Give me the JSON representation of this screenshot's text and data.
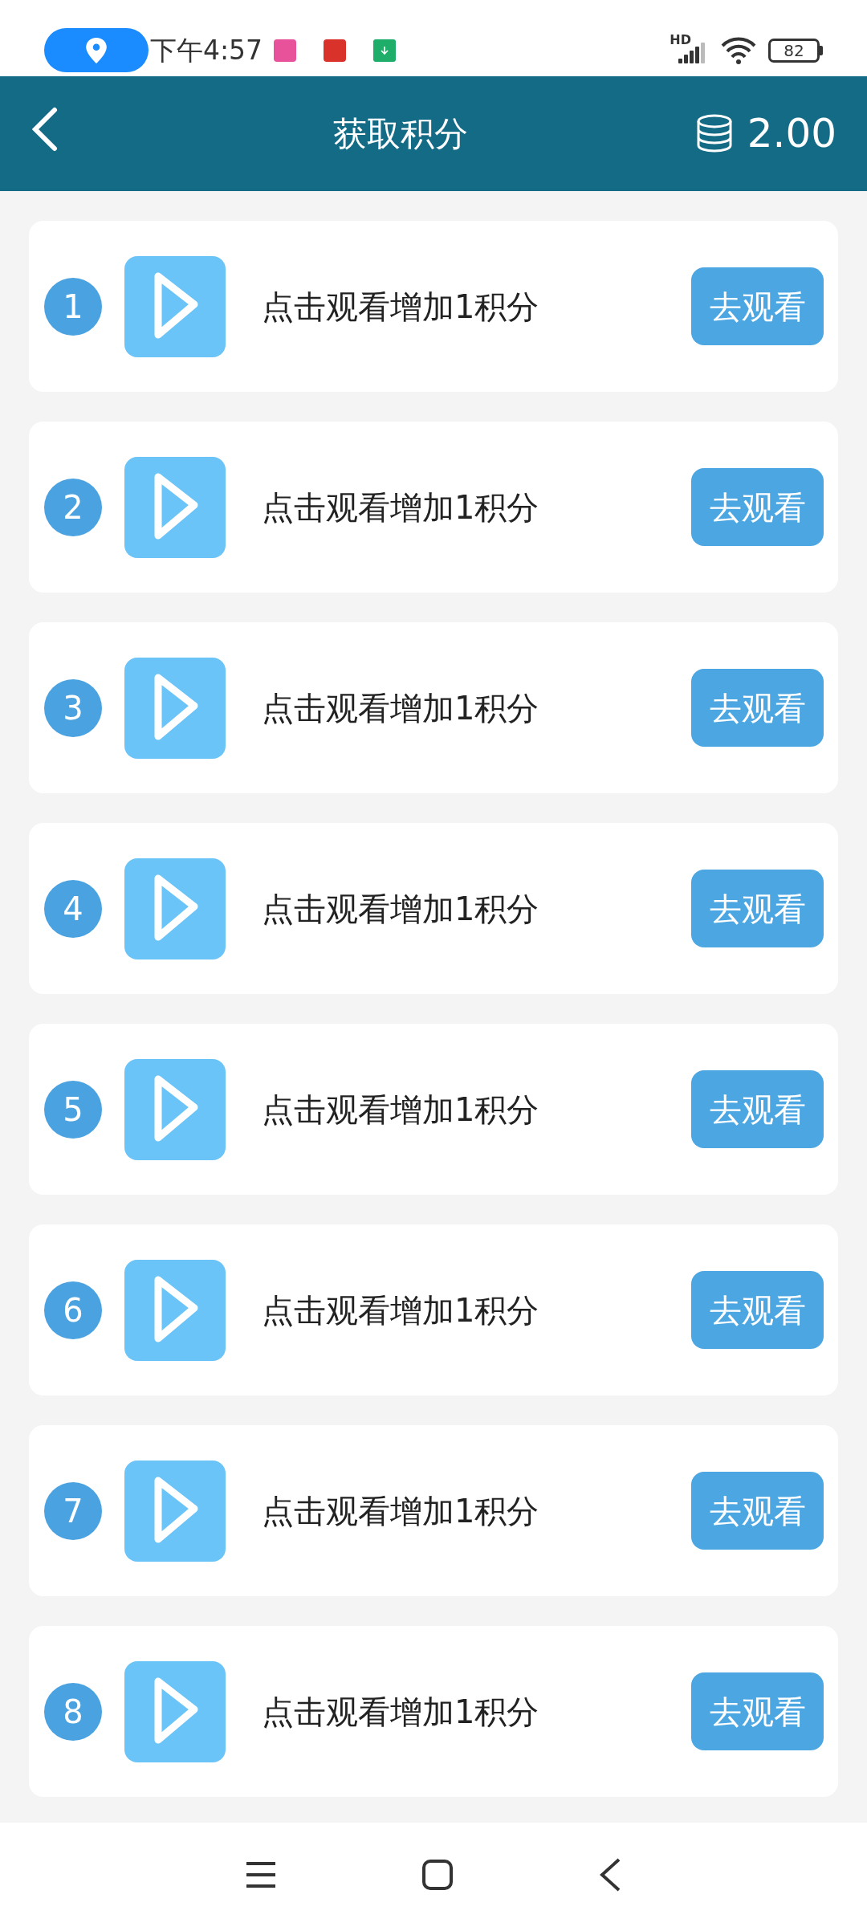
{
  "status_bar": {
    "time": "下午4:57",
    "network": "HD",
    "battery": "82"
  },
  "header": {
    "title": "获取积分",
    "points": "2.00"
  },
  "tasks": [
    {
      "number": "1",
      "text": "点击观看增加1积分",
      "button": "去观看"
    },
    {
      "number": "2",
      "text": "点击观看增加1积分",
      "button": "去观看"
    },
    {
      "number": "3",
      "text": "点击观看增加1积分",
      "button": "去观看"
    },
    {
      "number": "4",
      "text": "点击观看增加1积分",
      "button": "去观看"
    },
    {
      "number": "5",
      "text": "点击观看增加1积分",
      "button": "去观看"
    },
    {
      "number": "6",
      "text": "点击观看增加1积分",
      "button": "去观看"
    },
    {
      "number": "7",
      "text": "点击观看增加1积分",
      "button": "去观看"
    },
    {
      "number": "8",
      "text": "点击观看增加1积分",
      "button": "去观看"
    }
  ]
}
